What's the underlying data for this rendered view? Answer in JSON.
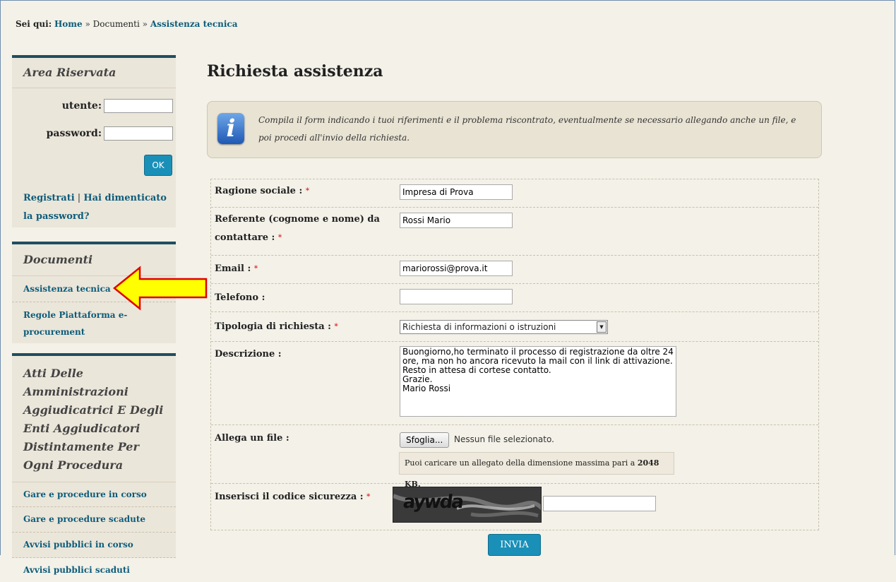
{
  "breadcrumb": {
    "label": "Sei qui:",
    "home": "Home",
    "documenti": "Documenti",
    "current": "Assistenza tecnica",
    "separator": "»"
  },
  "login": {
    "title": "Area Riservata",
    "user_label": "utente:",
    "password_label": "password:",
    "ok_label": "OK",
    "register": "Registrati",
    "forgot": "Hai dimenticato la password?"
  },
  "docs": {
    "title": "Documenti",
    "items": [
      "Assistenza tecnica",
      "Regole Piattaforma e-procurement"
    ]
  },
  "atti": {
    "title": "Atti Delle Amministrazioni Aggiudicatrici E Degli Enti Aggiudicatori Distintamente Per Ogni Procedura",
    "items": [
      "Gare e procedure in corso",
      "Gare e procedure scadute",
      "Avvisi pubblici in corso",
      "Avvisi pubblici scaduti"
    ]
  },
  "main": {
    "title": "Richiesta assistenza",
    "info": "Compila il form indicando i tuoi riferimenti e il problema riscontrato, eventualmente se necessario allegando anche un file, e poi procedi all'invio della richiesta."
  },
  "form": {
    "ragione_label": "Ragione sociale :",
    "ragione_value": "Impresa di Prova",
    "referente_label": "Referente (cognome e nome) da contattare :",
    "referente_value": "Rossi Mario",
    "email_label": "Email :",
    "email_value": "mariorossi@prova.it",
    "telefono_label": "Telefono :",
    "telefono_value": "",
    "tipologia_label": "Tipologia di richiesta :",
    "tipologia_value": "Richiesta di informazioni o istruzioni",
    "descrizione_label": "Descrizione :",
    "descrizione_value": "Buongiorno,ho terminato il processo di registrazione da oltre 24 ore, ma non ho ancora ricevuto la mail con il link di attivazione.\nResto in attesa di cortese contatto.\nGrazie.\nMario Rossi",
    "allega_label": "Allega un file :",
    "file_button": "Sfoglia...",
    "file_status": "Nessun file selezionato.",
    "file_hint": "Puoi caricare un allegato della dimensione massima pari a",
    "file_hint_size": "2048 KB.",
    "captcha_label": "Inserisci il codice sicurezza :",
    "captcha_text": "aywda",
    "required_mark": "*",
    "submit": "INVIA"
  },
  "colors": {
    "accent": "#1a90b8",
    "sidebar_border": "#1e4f60",
    "arrow_fill": "#ffff00",
    "arrow_stroke": "#e00000"
  }
}
